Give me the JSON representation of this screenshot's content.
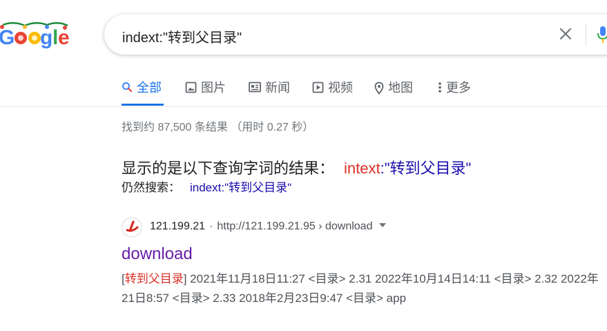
{
  "search": {
    "query": "indext:\"转到父目录\""
  },
  "tabs": [
    {
      "label": "全部",
      "icon": "search-icon",
      "active": true
    },
    {
      "label": "图片",
      "icon": "image-icon"
    },
    {
      "label": "新闻",
      "icon": "news-icon"
    },
    {
      "label": "视频",
      "icon": "play-icon"
    },
    {
      "label": "地图",
      "icon": "map-pin-icon"
    },
    {
      "label": "更多",
      "icon": "more-vert-icon"
    }
  ],
  "stats": "找到约 87,500 条结果 （用时 0.27 秒）",
  "correction": {
    "showing_prefix": "显示的是以下查询字词的结果：",
    "corrected_red": "intext",
    "corrected_rest": ":\"转到父目录\"",
    "instead_prefix": "仍然搜索：",
    "instead_query": "indext:\"转到父目录\""
  },
  "result": {
    "site_name": "121.199.21",
    "sep": "·",
    "url": "http://121.199.21.95 › download",
    "title": "download",
    "snippet_open": "[",
    "snippet_highlight": "转到父目录",
    "snippet_line1_rest": "] 2021年11月18日11:27 <目录> 2.31 2022年10月14日14:11 <目录> 2.32 2022年",
    "snippet_line2": "21日8:57 <目录> 2.33 2018年2月23日9:47 <目录> app"
  },
  "colors": {
    "accent": "#1a73e8",
    "link": "#1a0dab",
    "visited": "#681da8",
    "highlight": "#d93025"
  }
}
